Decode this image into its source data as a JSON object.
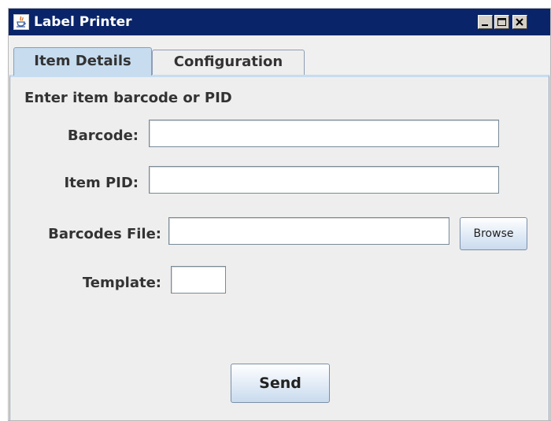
{
  "window": {
    "title": "Label Printer",
    "icon": "java-cup-icon",
    "controls": [
      "minimize-icon",
      "maximize-icon",
      "close-icon"
    ],
    "title_bar_color": "#0a246a"
  },
  "tabs": [
    {
      "label": "Item Details",
      "selected": true
    },
    {
      "label": "Configuration",
      "selected": false
    }
  ],
  "item_details": {
    "instruction": "Enter item barcode or PID",
    "barcode": {
      "label": "Barcode:",
      "value": ""
    },
    "item_pid": {
      "label": "Item PID:",
      "value": ""
    },
    "barcodes_file": {
      "label": "Barcodes File:",
      "value": "",
      "browse_label": "Browse"
    },
    "template": {
      "label": "Template:",
      "value": ""
    },
    "send_label": "Send"
  },
  "colors": {
    "selected_tab": "#c8dcf0",
    "panel_background": "#eeeeee",
    "button_gradient_bottom": "#c9dbee"
  }
}
